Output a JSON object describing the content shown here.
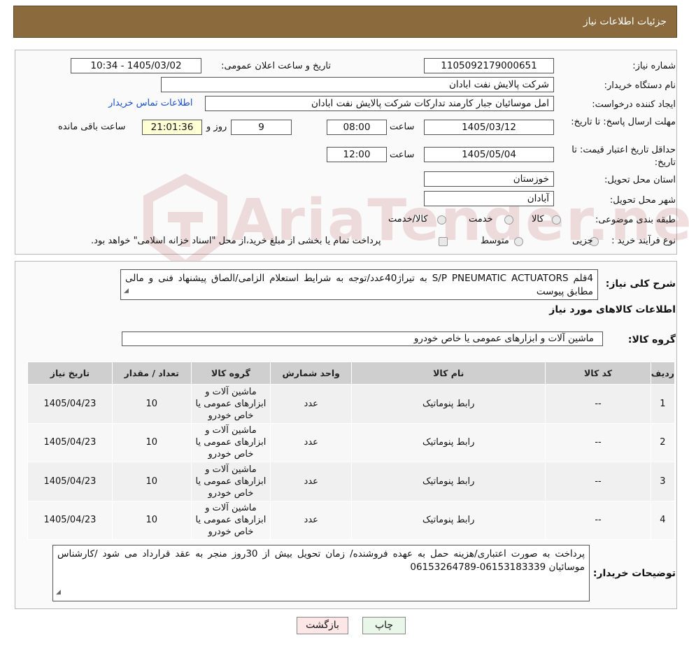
{
  "header": {
    "title": "جزئیات اطلاعات نیاز"
  },
  "form": {
    "need_number_label": "شماره نیاز:",
    "need_number": "1105092179000651",
    "announce_label": "تاریخ و ساعت اعلان عمومی:",
    "announce_value": "1405/03/02 - 10:34",
    "buyer_label": "نام دستگاه خریدار:",
    "buyer_value": "شرکت پالایش نفت ابادان",
    "creator_label": "ایجاد کننده درخواست:",
    "creator_value": "امل موسائیان جبار کارمند تدارکات شرکت پالایش نفت ابادان",
    "contact_link": "اطلاعات تماس خریدار",
    "deadline_label": "مهلت ارسال پاسخ: تا تاریخ:",
    "deadline_date": "1405/03/12",
    "hour_label": "ساعت",
    "deadline_time": "08:00",
    "days_value": "9",
    "days_label": "روز و",
    "remaining_time": "21:01:36",
    "remaining_label": "ساعت باقی مانده",
    "validity_label": "حداقل تاریخ اعتبار قیمت: تا تاریخ:",
    "validity_date": "1405/05/04",
    "validity_time": "12:00",
    "province_label": "استان محل تحویل:",
    "province_value": "خوزستان",
    "city_label": "شهر محل تحویل:",
    "city_value": "آبادان",
    "category_label": "طبقه بندی موضوعی:",
    "category_options": [
      "کالا",
      "خدمت",
      "کالا/خدمت"
    ],
    "process_label": "نوع فرآیند خرید :",
    "process_options": [
      "جزیی",
      "متوسط"
    ],
    "process_note": "پرداخت تمام یا بخشی از مبلغ خرید،از محل \"اسناد خزانه اسلامی\" خواهد بود."
  },
  "watermark": {
    "text": "AriaTender.neT"
  },
  "details": {
    "description_label": "شرح کلی نیاز:",
    "description_value": "4قلم S/P PNEUMATIC ACTUATORS به تیراژ40عدد/توجه به شرایط استعلام الزامی/الصاق پیشنهاد فنی و مالی مطابق پیوست",
    "goods_info_title": "اطلاعات کالاهای مورد نیاز",
    "goods_group_label": "گروه کالا:",
    "goods_group_value": "ماشین آلات و ابزارهای عمومی یا خاص خودرو"
  },
  "table": {
    "headers": [
      "ردیف",
      "کد کالا",
      "نام کالا",
      "واحد شمارش",
      "گروه کالا",
      "تعداد / مقدار",
      "تاریخ نیاز"
    ],
    "rows": [
      [
        "1",
        "--",
        "رابط پنوماتیک",
        "عدد",
        "ماشین آلات و ابزارهای عمومی یا خاص خودرو",
        "10",
        "1405/04/23"
      ],
      [
        "2",
        "--",
        "رابط پنوماتیک",
        "عدد",
        "ماشین آلات و ابزارهای عمومی یا خاص خودرو",
        "10",
        "1405/04/23"
      ],
      [
        "3",
        "--",
        "رابط پنوماتیک",
        "عدد",
        "ماشین آلات و ابزارهای عمومی یا خاص خودرو",
        "10",
        "1405/04/23"
      ],
      [
        "4",
        "--",
        "رابط پنوماتیک",
        "عدد",
        "ماشین آلات و ابزارهای عمومی یا خاص خودرو",
        "10",
        "1405/04/23"
      ]
    ]
  },
  "buyer_notes": {
    "label": "توضیحات خریدار:",
    "value": "پرداخت به صورت اعتباری/هزینه حمل به عهده فروشنده/ زمان تحویل بیش از 30روز منجر به عقد قرارداد می شود /کارشناس موسائیان 06153183339-06153264789"
  },
  "buttons": {
    "print": "چاپ",
    "back": "بازگشت"
  }
}
